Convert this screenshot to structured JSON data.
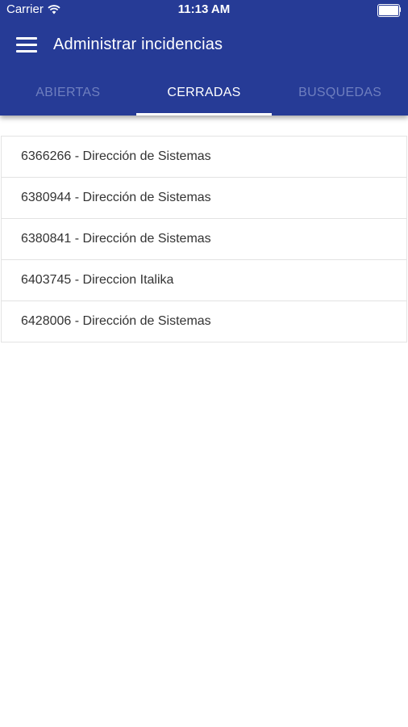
{
  "status_bar": {
    "carrier": "Carrier",
    "time": "11:13 AM",
    "wifi_icon": "wifi-icon",
    "battery_icon": "battery-icon",
    "battery_level": 1.0
  },
  "toolbar": {
    "menu_icon": "hamburger-menu-icon",
    "title": "Administrar incidencias"
  },
  "tabs": [
    {
      "label": "ABIERTAS",
      "active": false
    },
    {
      "label": "CERRADAS",
      "active": true
    },
    {
      "label": "BUSQUEDAS",
      "active": false
    }
  ],
  "list": {
    "items": [
      {
        "label": "6366266 - Dirección de Sistemas"
      },
      {
        "label": "6380944 - Dirección de Sistemas"
      },
      {
        "label": "6380841 - Dirección de Sistemas"
      },
      {
        "label": "6403745 - Direccion Italika"
      },
      {
        "label": "6428006 - Dirección de Sistemas"
      }
    ]
  },
  "colors": {
    "primary": "#263b96",
    "tab_inactive": "#6f7fbf",
    "tab_active": "#ffffff",
    "divider": "#e3e3e3",
    "item_text": "#333333"
  }
}
